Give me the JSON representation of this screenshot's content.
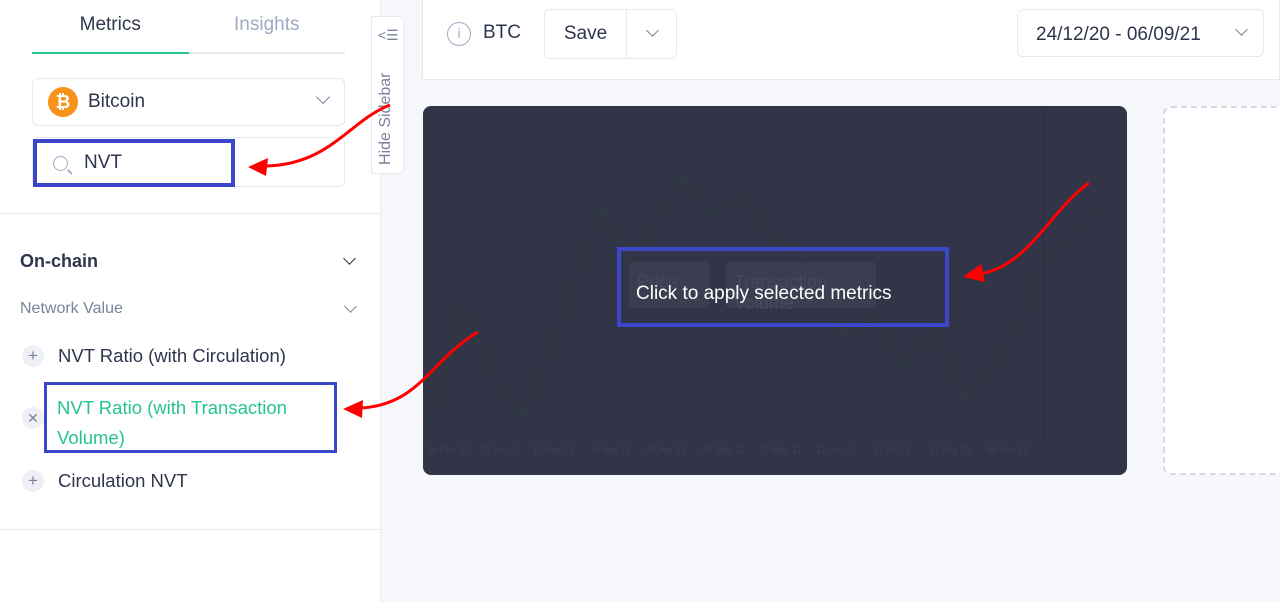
{
  "sidebar": {
    "tabs": [
      {
        "label": "Metrics",
        "active": true
      },
      {
        "label": "Insights",
        "active": false
      }
    ],
    "asset": {
      "label": "Bitcoin",
      "icon": "bitcoin-icon",
      "icon_glyph": "₿"
    },
    "search": {
      "value": "NVT",
      "icon": "search-icon"
    },
    "section": {
      "title": "On-chain",
      "subsection": "Network Value"
    },
    "items": [
      {
        "label": "NVT Ratio (with Circulation)",
        "state": "add"
      },
      {
        "label": "NVT Ratio (with Transaction Volume)",
        "state": "selected"
      },
      {
        "label": "Circulation NVT",
        "state": "add"
      }
    ],
    "hide_label": "Hide Sidebar"
  },
  "toolbar": {
    "ticker": "BTC",
    "save_label": "Save",
    "date_range": "24/12/20 - 06/09/21"
  },
  "chart": {
    "overlay_text": "Click to apply selected metrics",
    "pills": [
      "Price",
      "Transaction Volume"
    ],
    "x_labels": [
      "24 Dec 20",
      "15 Jan 21",
      "10 Feb 21",
      "10 Mar 21",
      "05 Apr 21",
      "01 May 21",
      "27 May 21",
      "21 Jun 21",
      "17 Jul 21",
      "12 Aug 21",
      "06 Sep 21"
    ]
  },
  "colors": {
    "accent": "#26c48c",
    "highlight": "#3b47c9",
    "annotation": "#ff0000",
    "chart_bg": "#323547"
  }
}
